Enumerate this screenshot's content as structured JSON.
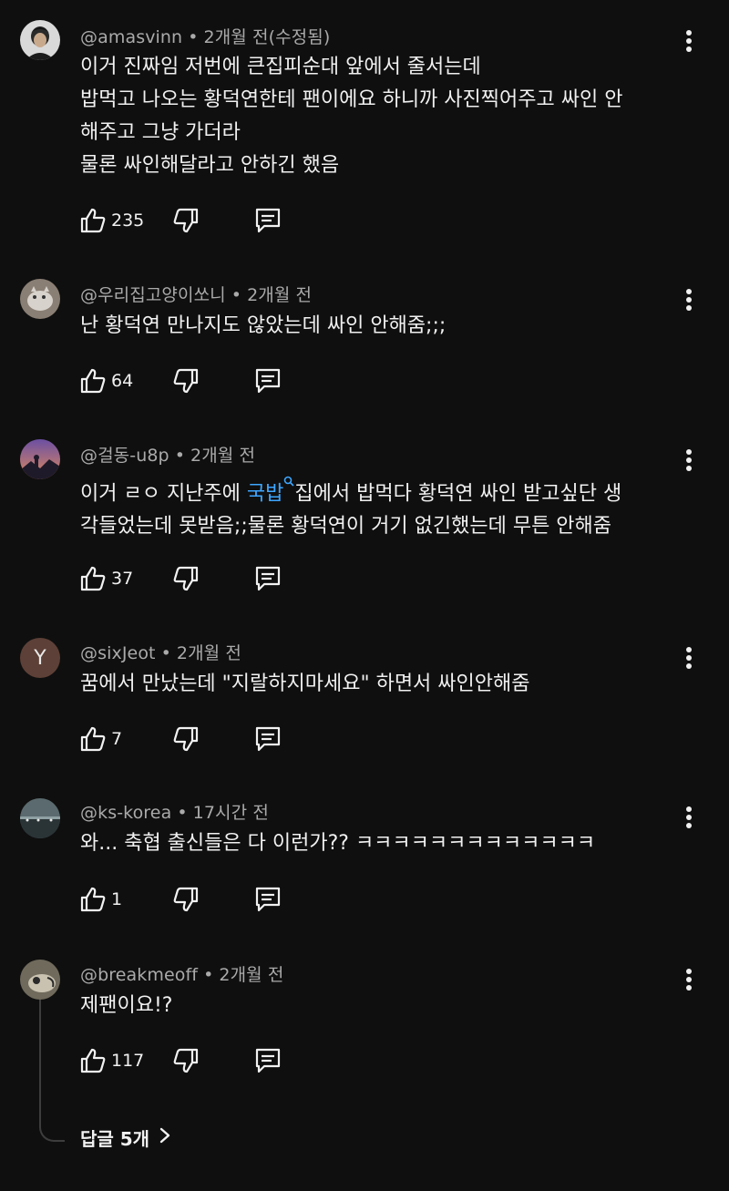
{
  "comments": [
    {
      "handle": "@amasvinn",
      "time": "2개월 전(수정됨)",
      "lines": [
        "이거 진짜임 저번에 큰집피순대 앞에서 줄서는데",
        "밥먹고 나오는 황덕연한테 팬이에요 하니까 사진찍어주고 싸인 안",
        "해주고 그냥 가더라",
        "물론 싸인해달라고 안하긴 했음"
      ],
      "likes": "235"
    },
    {
      "handle": "@우리집고양이쏘니",
      "time": "2개월 전",
      "lines": [
        "난 황덕연 만나지도 않았는데 싸인 안해줌;;;"
      ],
      "likes": "64"
    },
    {
      "handle": "@걸동-u8p",
      "time": "2개월 전",
      "line1_pre": "이거 ㄹㅇ 지난주에 ",
      "line1_link": "국밥",
      "line1_post": "집에서 밥먹다 황덕연 싸인 받고싶단 생",
      "line2": "각들었는데 못받음;;물론 황덕연이 거기 없긴했는데 무튼 안해줌",
      "likes": "37"
    },
    {
      "handle": "@sixJeot",
      "time": "2개월 전",
      "avatar_letter": "Y",
      "lines": [
        "꿈에서 만났는데 \"지랄하지마세요\" 하면서 싸인안해줌"
      ],
      "likes": "7"
    },
    {
      "handle": "@ks-korea",
      "time": "17시간 전",
      "lines": [
        "와... 축협 출신들은 다 이런가?? ㅋㅋㅋㅋㅋㅋㅋㅋㅋㅋㅋㅋㅋ"
      ],
      "likes": "1"
    },
    {
      "handle": "@breakmeoff",
      "time": "2개월 전",
      "lines": [
        "제팬이요!?"
      ],
      "likes": "117"
    }
  ],
  "replies_label": "답글 5개",
  "separator": "•",
  "colors": {
    "background": "#0f0f0f",
    "text": "#f1f1f1",
    "meta": "#aaaaaa",
    "link": "#3ea6ff",
    "avatar_letter_bg": "#5d4037"
  },
  "icons": [
    "like-icon",
    "dislike-icon",
    "reply-icon",
    "more-vertical-icon",
    "search-icon",
    "chevron-right-icon"
  ]
}
